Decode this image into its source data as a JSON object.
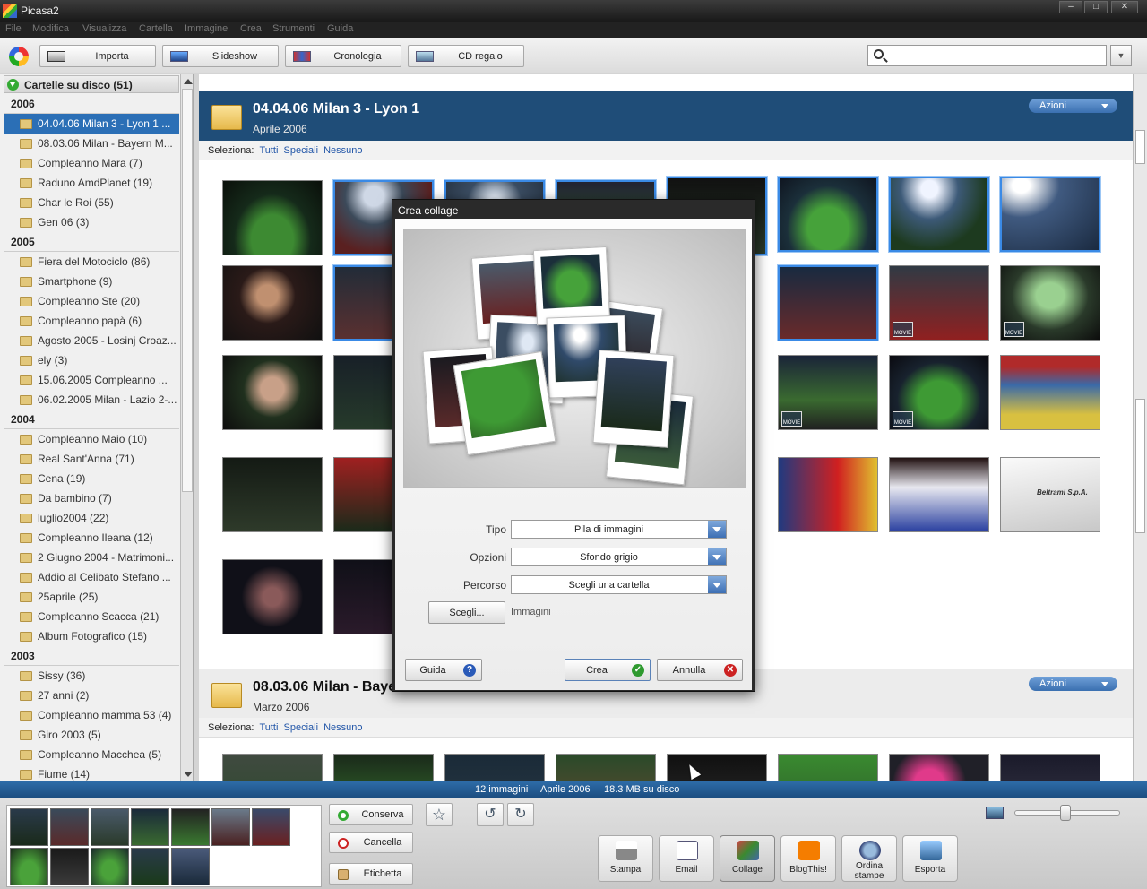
{
  "window": {
    "title": "Picasa2"
  },
  "menu": [
    "File",
    "Modifica",
    "Visualizza",
    "Cartella",
    "Immagine",
    "Crea",
    "Strumenti",
    "Guida"
  ],
  "toolbar": {
    "import_label": "Importa",
    "slideshow_label": "Slideshow",
    "timeline_label": "Cronologia",
    "giftcd_label": "CD regalo"
  },
  "search": {
    "value": ""
  },
  "sidebar": {
    "header": "Cartelle su disco (51)",
    "groups": [
      {
        "year": "2006",
        "folders": [
          "04.04.06 Milan 3 - Lyon 1 ...",
          "08.03.06 Milan - Bayern M...",
          "Compleanno Mara (7)",
          "Raduno AmdPlanet (19)",
          "Char le Roi (55)",
          "Gen 06 (3)"
        ]
      },
      {
        "year": "2005",
        "folders": [
          "Fiera del Motociclo (86)",
          "Smartphone (9)",
          "Compleanno Ste (20)",
          "Compleanno papà (6)",
          "Agosto 2005 - Losinj Croaz...",
          "ely (3)",
          "15.06.2005 Compleanno ...",
          "06.02.2005 Milan - Lazio 2-..."
        ]
      },
      {
        "year": "2004",
        "folders": [
          "Compleanno Maio (10)",
          "Real Sant'Anna (71)",
          "Cena (19)",
          "Da bambino (7)",
          "luglio2004 (22)",
          "Compleanno Ileana (12)",
          "2 Giugno 2004 - Matrimoni...",
          "Addio al Celibato Stefano ...",
          "25aprile (25)",
          "Compleanno Scacca (21)",
          "Album Fotografico (15)"
        ]
      },
      {
        "year": "2003",
        "folders": [
          "Sissy (36)",
          "27 anni (2)",
          "Compleanno mamma 53 (4)",
          "Giro 2003 (5)",
          "Compleanno Macchea (5)",
          "Fiume (14)"
        ]
      }
    ]
  },
  "albums": [
    {
      "title": "04.04.06 Milan 3 - Lyon 1",
      "date": "Aprile 2006",
      "actions": "Azioni"
    },
    {
      "title": "08.03.06 Milan - Baye",
      "date": "Marzo 2006",
      "actions": "Azioni"
    }
  ],
  "select_row": {
    "label": "Seleziona:",
    "all": "Tutti",
    "special": "Speciali",
    "none": "Nessuno"
  },
  "thumb_overlay": {
    "movie": "MOVIE",
    "sign": "Beltrami S.p.A."
  },
  "status": {
    "count": "12 immagini",
    "date": "Aprile 2006",
    "size": "18.3 MB su disco"
  },
  "tray": {
    "keep": "Conserva",
    "clear": "Cancella",
    "label": "Etichetta"
  },
  "actions": {
    "print": "Stampa",
    "email": "Email",
    "collage": "Collage",
    "blog": "BlogThis!",
    "order": "Ordina stampe",
    "export": "Esporta"
  },
  "dialog": {
    "title": "Crea collage",
    "type_label": "Tipo",
    "type_value": "Pila di immagini",
    "options_label": "Opzioni",
    "options_value": "Sfondo grigio",
    "path_label": "Percorso",
    "path_value": "Scegli una cartella",
    "choose_label": "Scegli...",
    "source_text": "Immagini",
    "help_label": "Guida",
    "create_label": "Crea",
    "cancel_label": "Annulla"
  },
  "colors": {
    "accent": "#1f4d78",
    "selection": "#2b6fb6",
    "status": "#2e6ca8"
  }
}
